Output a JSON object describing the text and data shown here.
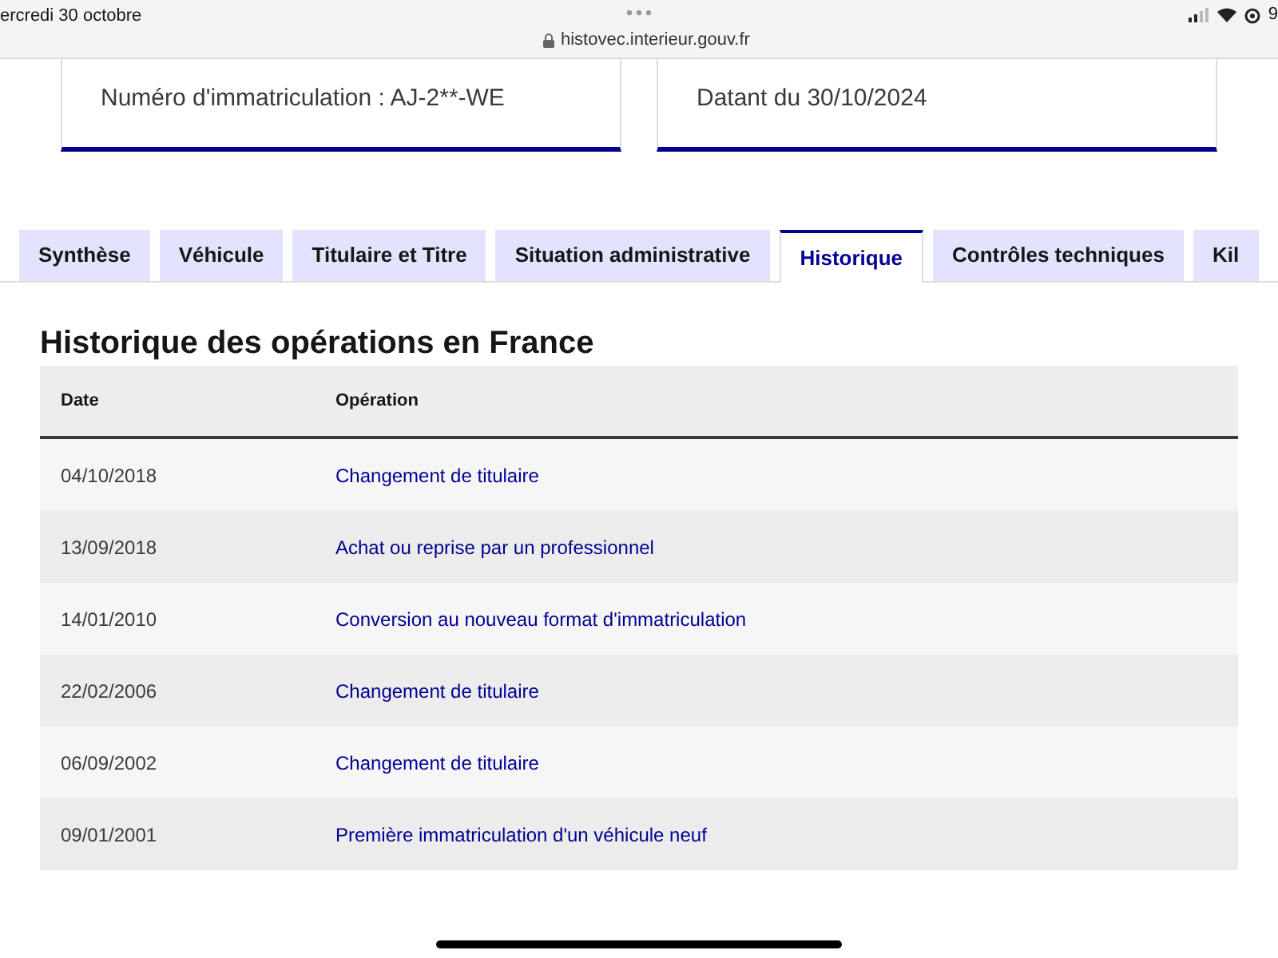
{
  "status_bar": {
    "date": "ercredi 30 octobre",
    "url": "histovec.interieur.gouv.fr",
    "battery": "9"
  },
  "cards": [
    {
      "text": "Numéro d'immatriculation : AJ-2**-WE"
    },
    {
      "text": "Datant du 30/10/2024"
    }
  ],
  "tabs": [
    {
      "label": "Synthèse",
      "selected": false
    },
    {
      "label": "Véhicule",
      "selected": false
    },
    {
      "label": "Titulaire et Titre",
      "selected": false
    },
    {
      "label": "Situation administrative",
      "selected": false
    },
    {
      "label": "Historique",
      "selected": true
    },
    {
      "label": "Contrôles techniques",
      "selected": false
    },
    {
      "label": "Kil",
      "selected": false
    }
  ],
  "heading": "Historique des opérations en France",
  "table": {
    "columns": [
      "Date",
      "Opération"
    ],
    "rows": [
      [
        "04/10/2018",
        "Changement de titulaire"
      ],
      [
        "13/09/2018",
        "Achat ou reprise par un professionnel"
      ],
      [
        "14/01/2010",
        "Conversion au nouveau format d'immatriculation"
      ],
      [
        "22/02/2006",
        "Changement de titulaire"
      ],
      [
        "06/09/2002",
        "Changement de titulaire"
      ],
      [
        "09/01/2001",
        "Première immatriculation d'un véhicule neuf"
      ]
    ]
  }
}
